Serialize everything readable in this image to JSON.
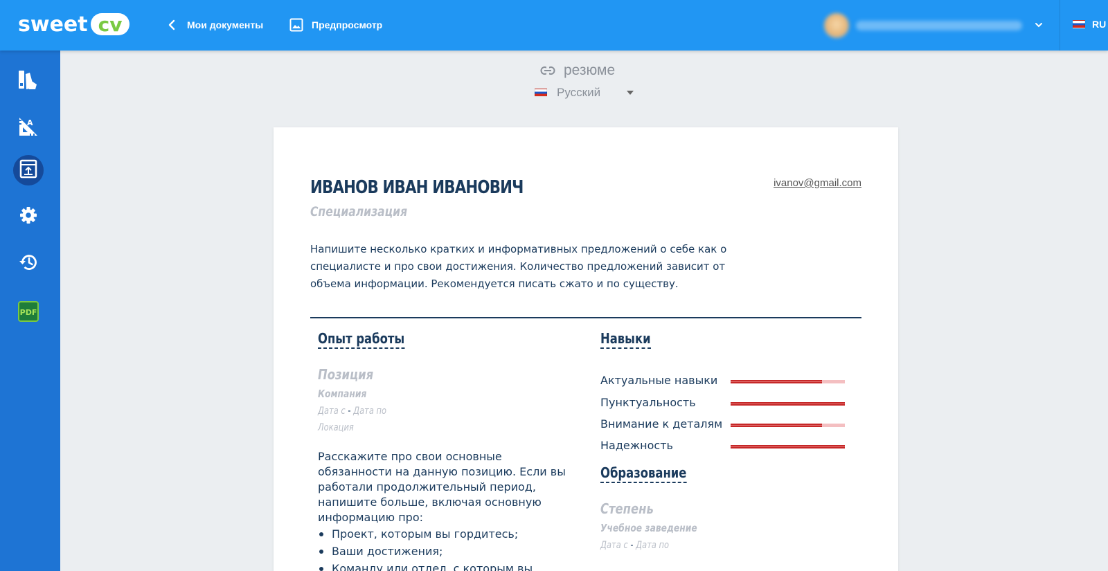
{
  "app": {
    "logo_sweet": "sweet",
    "logo_cv": "cv"
  },
  "topbar": {
    "back_label": "Мои документы",
    "preview_label": "Предпросмотр",
    "lang_code": "RU"
  },
  "sidebar": {
    "items": [
      {
        "icon": "templates-icon",
        "active": false
      },
      {
        "icon": "typography-icon",
        "active": false
      },
      {
        "icon": "layout-icon",
        "active": true
      },
      {
        "icon": "gear-icon",
        "active": false
      },
      {
        "icon": "history-icon",
        "active": false
      },
      {
        "icon": "pdf-icon",
        "active": false,
        "text": "PDF"
      }
    ]
  },
  "document": {
    "title": "резюме",
    "language": "Русский"
  },
  "resume": {
    "name": "ИВАНОВ ИВАН ИВАНОВИЧ",
    "email": "ivanov@gmail.com",
    "specialization": "Специализация",
    "about": "Напишите несколько кратких и информативных предложений о себе как о специалисте и про свои достижения. Количество предложений зависит от объема информации. Рекомендуется писать сжато и по существу.",
    "experience": {
      "title": "Опыт работы",
      "position": "Позиция",
      "company": "Компания",
      "date_from": "Дата с",
      "date_sep": "-",
      "date_to": "Дата по",
      "location": "Локация",
      "description": "Расскажите про свои основные обязанности на данную позицию. Если вы работали продолжительный период, напишите больше, включая основную информацию про:",
      "bullets": [
        "Проект, которым вы гордитесь;",
        "Ваши достижения;",
        "Команду или отдел, с которым вы"
      ]
    },
    "skills": {
      "title": "Навыки",
      "items": [
        {
          "label": "Актуальные навыки",
          "level": 0.8
        },
        {
          "label": "Пунктуальность",
          "level": 1.0
        },
        {
          "label": "Внимание к деталям",
          "level": 0.8
        },
        {
          "label": "Надежность",
          "level": 1.0
        }
      ]
    },
    "education": {
      "title": "Образование",
      "degree": "Степень",
      "institution": "Учебное заведение",
      "date_from": "Дата с",
      "date_sep": "-",
      "date_to": "Дата по"
    }
  },
  "colors": {
    "topbar": "#2196f3",
    "sidebar": "#1e74d4",
    "sidebar_active": "#154a9a",
    "text_dark": "#1a3a5c",
    "placeholder": "#b9bec7",
    "skill_fill": "#c62828",
    "skill_track": "#f4bfc1",
    "logo_green": "#7ac943"
  }
}
